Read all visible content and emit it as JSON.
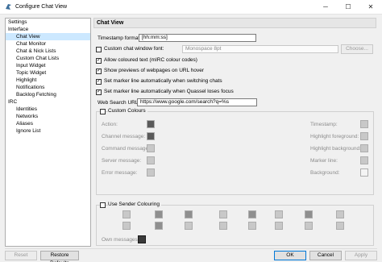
{
  "window": {
    "title": "Configure Chat View",
    "minimize": "─",
    "maximize": "☐",
    "close": "✕"
  },
  "tree": [
    {
      "label": "Settings",
      "level": 0
    },
    {
      "label": "Interface",
      "level": 0
    },
    {
      "label": "Chat View",
      "level": 1,
      "selected": true
    },
    {
      "label": "Chat Monitor",
      "level": 1
    },
    {
      "label": "Chat & Nick Lists",
      "level": 1
    },
    {
      "label": "Custom Chat Lists",
      "level": 1
    },
    {
      "label": "Input Widget",
      "level": 1
    },
    {
      "label": "Topic Widget",
      "level": 1
    },
    {
      "label": "Highlight",
      "level": 1
    },
    {
      "label": "Notifications",
      "level": 1
    },
    {
      "label": "Backlog Fetching",
      "level": 1
    },
    {
      "label": "IRC",
      "level": 0
    },
    {
      "label": "Identities",
      "level": 1
    },
    {
      "label": "Networks",
      "level": 1
    },
    {
      "label": "Aliases",
      "level": 1
    },
    {
      "label": "Ignore List",
      "level": 1
    }
  ],
  "panel": {
    "header": "Chat View",
    "timestamp_label": "Timestamp format:",
    "timestamp_value": "[hh:mm:ss]",
    "custom_font_label": "Custom chat window font:",
    "font_value": "Monospace 8pt",
    "choose_button": "Choose...",
    "allow_coloured_label": "Allow coloured text (mIRC colour codes)",
    "show_previews_label": "Show previews of webpages on URL hover",
    "marker_switch_label": "Set marker line automatically when switching chats",
    "marker_focus_label": "Set marker line automatically when Quassel loses focus",
    "web_search_label": "Web Search URL:",
    "web_search_value": "https://www.google.com/search?q=%s",
    "custom_colours_label": "Custom Colours",
    "colours_left": [
      "Action:",
      "Channel message:",
      "Command message:",
      "Server message:",
      "Error message:"
    ],
    "colours_right": [
      "Timestamp:",
      "Highlight foreground:",
      "Highlight background:",
      "Marker line:",
      "Background:"
    ],
    "sender_colouring_label": "Use Sender Colouring",
    "own_messages_label": "Own messages:"
  },
  "footer": {
    "reset": "Reset",
    "restore_defaults": "Restore Defaults",
    "ok": "OK",
    "cancel": "Cancel",
    "apply": "Apply"
  }
}
